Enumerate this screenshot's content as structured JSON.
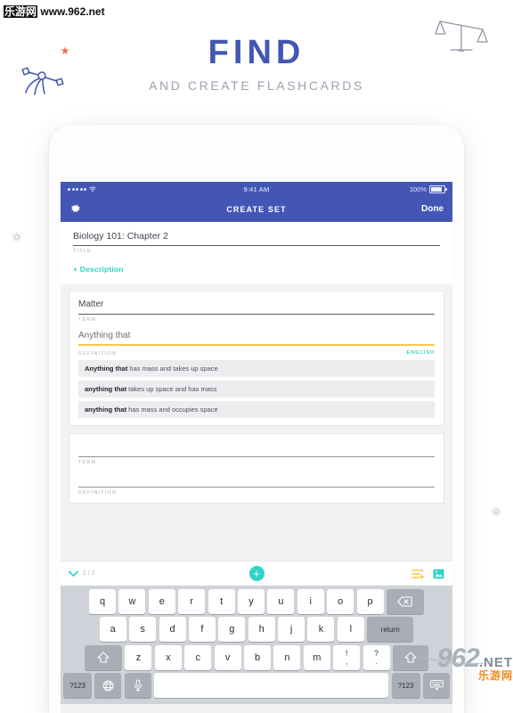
{
  "watermarks": {
    "top_cn": "乐游网",
    "top_url": "www.962.net",
    "bottom_num": "962",
    "bottom_net": ".NET",
    "bottom_cn": "乐游网"
  },
  "hero": {
    "title": "FIND",
    "subtitle": "AND CREATE FLASHCARDS",
    "title_color": "#4256b2",
    "subtitle_color": "#9aa2ad",
    "decorations": [
      "scale-icon",
      "atom-icon",
      "star-icon",
      "dot-icon",
      "dot-icon"
    ]
  },
  "device": {
    "statusbar": {
      "time": "9:41 AM",
      "battery_percent": "100%",
      "signal_dots": 5,
      "wifi": "wifi-icon"
    },
    "navbar": {
      "settings_icon": "gear-icon",
      "title": "CREATE SET",
      "done_label": "Done",
      "bg_color": "#4456b5"
    },
    "form": {
      "set_title_value": "Biology 101: Chapter 2",
      "set_title_label": "TITLE",
      "description_link": "+ Description",
      "description_color": "#2fd4c6"
    },
    "cards": [
      {
        "term_value": "Matter",
        "term_label": "TERM",
        "definition_value": "Anything that",
        "definition_label": "DEFINITION",
        "language_label": "ENGLISH",
        "underline_color": "#f7c948",
        "suggestions": [
          {
            "bold": "Anything that",
            "rest": " has mass and takes up space"
          },
          {
            "bold": "anything that",
            "rest": " takes up space and has mass"
          },
          {
            "bold": "anything that",
            "rest": " has mass and occupies space"
          }
        ]
      },
      {
        "term_value": "",
        "term_label": "TERM",
        "definition_value": "",
        "definition_label": "DEFINITION",
        "suggestions": []
      }
    ],
    "toolbar": {
      "collapse_icon": "chevron-down-icon",
      "card_counter": "1 / 2",
      "add_card_icon": "plus-icon",
      "add_card_color": "#2fd4c6",
      "add_rows_icon": "add-rows-icon",
      "add_rows_color": "#f7c948",
      "image_icon": "image-icon",
      "image_color": "#2fd4c6"
    },
    "keyboard": {
      "row1": [
        "q",
        "w",
        "e",
        "r",
        "t",
        "y",
        "u",
        "i",
        "o",
        "p"
      ],
      "row1_action": "delete-icon",
      "row2": [
        "a",
        "s",
        "d",
        "f",
        "g",
        "h",
        "j",
        "k",
        "l"
      ],
      "row2_action": "return",
      "row3_shift": "shift-icon",
      "row3": [
        "z",
        "x",
        "c",
        "v",
        "b",
        "n",
        "m"
      ],
      "row3_punct": [
        {
          "top": "!",
          "bottom": ","
        },
        {
          "top": "?",
          "bottom": "."
        }
      ],
      "row3_shift2": "shift-icon",
      "row4_num_left": "?123",
      "row4_globe": "globe-icon",
      "row4_mic": "microphone-icon",
      "row4_space": "",
      "row4_num_right": "?123",
      "row4_dismiss": "hide-keyboard-icon"
    }
  }
}
